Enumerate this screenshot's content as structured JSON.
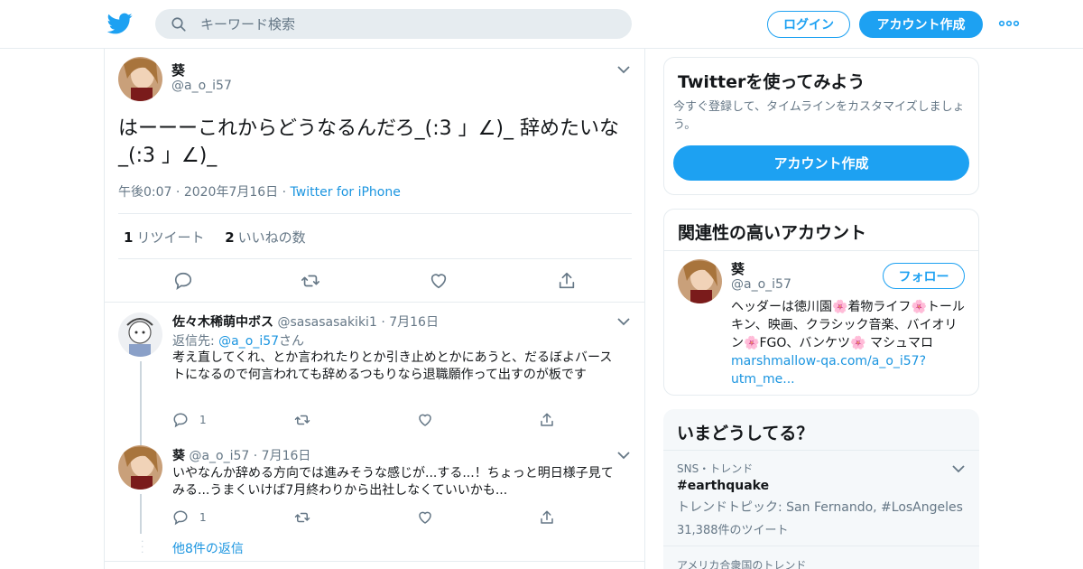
{
  "header": {
    "search_placeholder": "キーワード検索",
    "login_label": "ログイン",
    "signup_label": "アカウント作成"
  },
  "tweet": {
    "name": "葵",
    "handle": "@a_o_i57",
    "text": "はーーーこれからどうなるんだろ_(:3 」∠)_ 辞めたいな_(:3 」∠)_",
    "time": "午後0:07",
    "date": "2020年7月16日",
    "source": "Twitter for iPhone",
    "retweet_count": "1",
    "retweet_label": "リツイート",
    "like_count": "2",
    "like_label": "いいねの数"
  },
  "replies": [
    {
      "name": "佐々木稀萌中ボス",
      "handle": "@sasasasakiki1",
      "date": "7月16日",
      "reply_to_prefix": "返信先: ",
      "reply_to_handle": "@a_o_i57",
      "reply_to_suffix": "さん",
      "text": "考え直してくれ、とか言われたりとか引き止めとかにあうと、だるぼよバーストになるので何言われても辞めるつもりなら退職願作って出すのが板です",
      "reply_count": "1"
    },
    {
      "name": "葵",
      "handle": "@a_o_i57",
      "date": "7月16日",
      "text": "いやなんか辞める方向では進みそうな感じが...する...！ちょっと明日様子見てみる...うまくいけば7月終わりから出社しなくていいかも...",
      "reply_count": "1"
    }
  ],
  "more_replies_label": "他8件の返信",
  "sidebar": {
    "signup_card": {
      "title": "Twitterを使ってみよう",
      "subtitle": "今すぐ登録して、タイムラインをカスタマイズしましょう。",
      "button": "アカウント作成"
    },
    "related": {
      "title": "関連性の高いアカウント",
      "name": "葵",
      "handle": "@a_o_i57",
      "follow_label": "フォロー",
      "bio_1": "ヘッダーは徳川園",
      "bio_2": "着物ライフ",
      "bio_3": "トールキン、映画、クラシック音楽、バイオリン",
      "bio_4": "FGO、バンケツ",
      "bio_5": " マシュマロ",
      "bio_link": "marshmallow-qa.com/a_o_i57?utm_me...",
      "flower": "🌸"
    },
    "trends": {
      "title": "いまどうしてる？",
      "items": [
        {
          "context": "SNS・トレンド",
          "tag": "#earthquake",
          "desc": "トレンドトピック: San Fernando, #LosAngeles",
          "count": "31,388件のツイート"
        },
        {
          "context": "アメリカ合衆国のトレンド"
        }
      ]
    }
  },
  "colors": {
    "accent": "#1da1f2",
    "link": "#1b95e0",
    "muted": "#657786",
    "border": "#e6ecf0"
  }
}
